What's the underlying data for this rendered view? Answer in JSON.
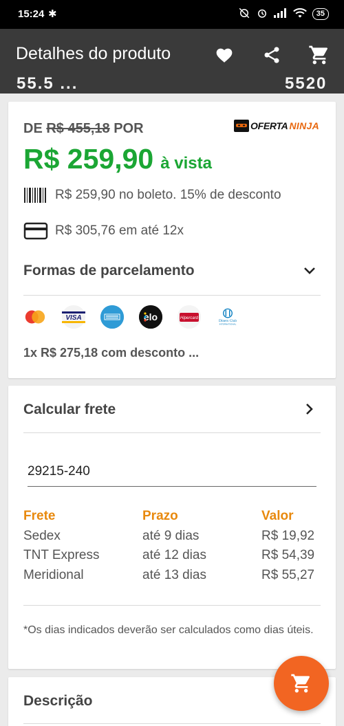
{
  "status_bar": {
    "time": "15:24",
    "bluetooth": "✱",
    "battery": "35"
  },
  "app_bar": {
    "title": "Detalhes do produto",
    "ghost_left": "55.5 ...",
    "ghost_right": "5520"
  },
  "pricing": {
    "de_label": "DE",
    "old_price": "R$ 455,18",
    "por_label": "POR",
    "price": "R$ 259,90",
    "price_suffix": "à vista",
    "brand_oferta": "OFERTA",
    "brand_ninja": "NINJA",
    "boleto_text": "R$ 259,90 no boleto. 15% de desconto",
    "cartao_text": "R$ 305,76 em até 12x"
  },
  "parcelamento": {
    "title": "Formas de parcelamento",
    "summary": "1x R$ 275,18 com desconto ...",
    "brands": [
      "Mastercard",
      "VISA",
      "American Express",
      "elo",
      "Hipercard",
      "Diners Club"
    ]
  },
  "frete": {
    "title": "Calcular frete",
    "cep": "29215-240",
    "headers": {
      "frete": "Frete",
      "prazo": "Prazo",
      "valor": "Valor"
    },
    "rows": [
      {
        "frete": "Sedex",
        "prazo": "até 9 dias",
        "valor": "R$ 19,92"
      },
      {
        "frete": "TNT Express",
        "prazo": "até 12 dias",
        "valor": "R$ 54,39"
      },
      {
        "frete": "Meridional",
        "prazo": "até 13 dias",
        "valor": "R$ 55,27"
      }
    ],
    "note": "*Os dias indicados deverão ser calculados como dias úteis."
  },
  "descricao": {
    "title": "Descrição"
  },
  "colors": {
    "green": "#1ba634",
    "orange": "#e8890e",
    "fab": "#f26522",
    "appbar": "#3a3a3a"
  }
}
